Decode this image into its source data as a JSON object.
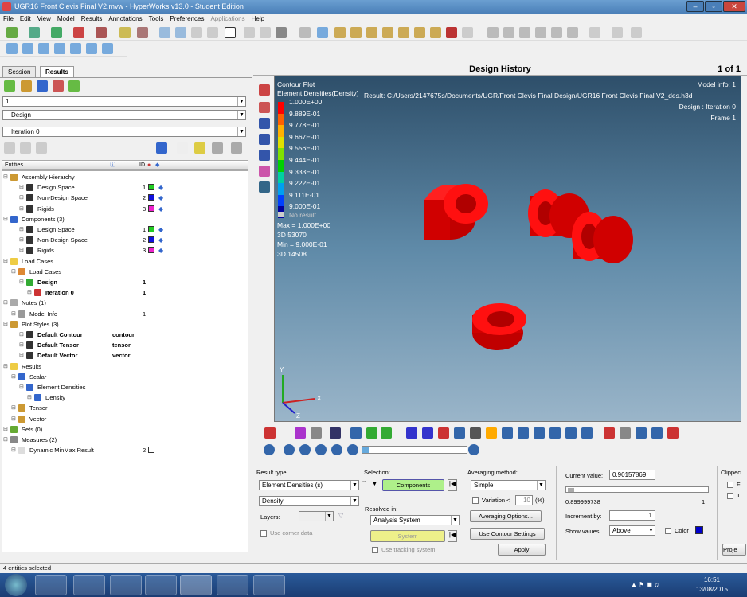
{
  "window": {
    "title": "UGR16 Front Clevis Final V2.mvw - HyperWorks v13.0 - Student Edition"
  },
  "menu": [
    "File",
    "Edit",
    "View",
    "Model",
    "Results",
    "Annotations",
    "Tools",
    "Preferences",
    "Applications",
    "Help"
  ],
  "left_panel": {
    "tabs": [
      "Session",
      "Results"
    ],
    "page_select": "1",
    "design_select": "Design",
    "iteration_select": "Iteration 0",
    "tree_header": {
      "entities": "Entities",
      "id": "ID"
    },
    "tree": [
      {
        "label": "Assembly Hierarchy",
        "bold": false,
        "id": "",
        "color": ""
      },
      {
        "label": "Design Space",
        "bold": false,
        "id": "1",
        "color": "#22cc22"
      },
      {
        "label": "Non-Design Space",
        "bold": false,
        "id": "2",
        "color": "#1111dd"
      },
      {
        "label": "Rigids",
        "bold": false,
        "id": "3",
        "color": "#ee22cc"
      },
      {
        "label": "Components (3)",
        "bold": false,
        "id": "",
        "color": ""
      },
      {
        "label": "Design Space",
        "bold": false,
        "id": "1",
        "color": "#22cc22"
      },
      {
        "label": "Non-Design Space",
        "bold": false,
        "id": "2",
        "color": "#1111dd"
      },
      {
        "label": "Rigids",
        "bold": false,
        "id": "3",
        "color": "#ee22cc"
      },
      {
        "label": "Load Cases",
        "bold": false,
        "id": "",
        "color": ""
      },
      {
        "label": "Load Cases",
        "bold": false,
        "id": "",
        "color": ""
      },
      {
        "label": "Design",
        "bold": true,
        "id": "1",
        "color": ""
      },
      {
        "label": "Iteration 0",
        "bold": true,
        "id": "1",
        "color": ""
      },
      {
        "label": "Notes (1)",
        "bold": false,
        "id": "",
        "color": ""
      },
      {
        "label": "Model Info",
        "bold": false,
        "id": "1",
        "color": ""
      },
      {
        "label": "Plot Styles (3)",
        "bold": false,
        "id": "",
        "color": ""
      },
      {
        "label": "Default Contour",
        "bold": true,
        "id": "contour",
        "color": ""
      },
      {
        "label": "Default Tensor",
        "bold": true,
        "id": "tensor",
        "color": ""
      },
      {
        "label": "Default Vector",
        "bold": true,
        "id": "vector",
        "color": ""
      },
      {
        "label": "Results",
        "bold": false,
        "id": "",
        "color": ""
      },
      {
        "label": "Scalar",
        "bold": false,
        "id": "",
        "color": ""
      },
      {
        "label": "Element Densities",
        "bold": false,
        "id": "",
        "color": ""
      },
      {
        "label": "Density",
        "bold": false,
        "id": "",
        "color": ""
      },
      {
        "label": "Tensor",
        "bold": false,
        "id": "",
        "color": ""
      },
      {
        "label": "Vector",
        "bold": false,
        "id": "",
        "color": ""
      },
      {
        "label": "Sets (0)",
        "bold": false,
        "id": "",
        "color": ""
      },
      {
        "label": "Measures (2)",
        "bold": false,
        "id": "",
        "color": ""
      },
      {
        "label": "Dynamic MinMax Result",
        "bold": false,
        "id": "2",
        "color": "#ffffff"
      }
    ]
  },
  "viewport": {
    "title": "Design History",
    "page": "1 of 1",
    "contour_title": "Contour Plot",
    "contour_subtitle": "Element Densities(Density)",
    "result_path": "Result: C:/Users/2147675s/Documents/UGR/Front Clevis Final Design/UGR16 Front Clevis Final V2_des.h3d",
    "model_info": "Model info: 1",
    "design_info": "Design : Iteration 0",
    "frame": "Frame 1",
    "legend": [
      "1.000E+00",
      "9.889E-01",
      "9.778E-01",
      "9.667E-01",
      "9.556E-01",
      "9.444E-01",
      "9.333E-01",
      "9.222E-01",
      "9.111E-01",
      "9.000E-01"
    ],
    "legend_colors": [
      "#ff0000",
      "#ff6000",
      "#ffb000",
      "#e0e000",
      "#80e000",
      "#00d000",
      "#00d0a0",
      "#00a0f0",
      "#0040ff",
      "#0000a0"
    ],
    "no_result": "No result",
    "max": "Max = 1.000E+00",
    "max_id": "3D 53070",
    "min": "Min = 9.000E-01",
    "min_id": "3D 14508",
    "axis_y": "Y",
    "axis_x": "X",
    "axis_z": "Z"
  },
  "controls": {
    "result_type_label": "Result type:",
    "result_type": "Element Densities (s)",
    "result_component": "Density",
    "layers_label": "Layers:",
    "use_corner_data": "Use corner data",
    "selection_label": "Selection:",
    "components_btn": "Components",
    "resolved_in_label": "Resolved in:",
    "resolved_in": "Analysis System",
    "system_btn": "System",
    "use_tracking": "Use tracking system",
    "averaging_label": "Averaging method:",
    "averaging": "Simple",
    "variation_label": "Variation <",
    "variation_value": "10",
    "variation_unit": "(%)",
    "averaging_options_btn": "Averaging Options...",
    "use_contour_settings_btn": "Use Contour Settings",
    "apply_btn": "Apply",
    "current_value_label": "Current value:",
    "current_value": "0.90157869",
    "slider_min": "0.899999738",
    "slider_max": "1",
    "increment_label": "Increment by:",
    "increment": "1",
    "show_values_label": "Show values:",
    "show_values": "Above",
    "color_label": "Color",
    "clipped_label": "Clippec",
    "clip_f": "Fi",
    "clip_t": "T",
    "proj_btn": "Proje"
  },
  "status": "4 entities selected",
  "clock": {
    "time": "16:51",
    "date": "13/08/2015"
  }
}
